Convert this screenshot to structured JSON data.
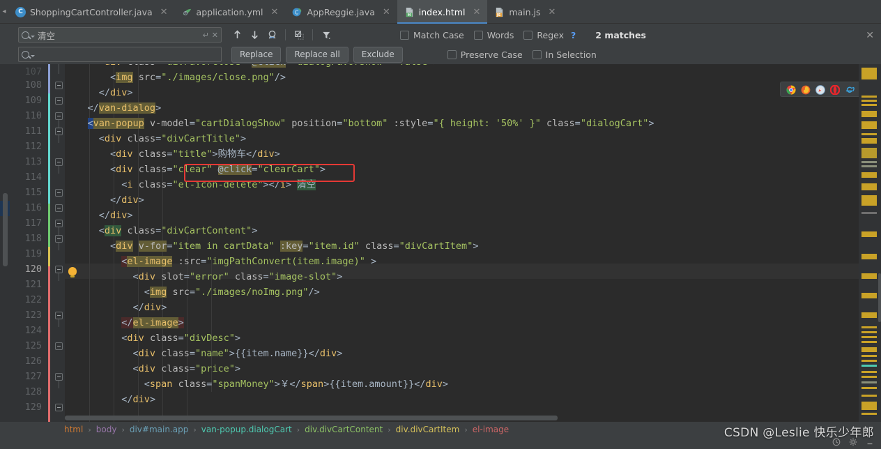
{
  "tabs": [
    {
      "label": "ShoppingCartController.java",
      "icon": "java-class-icon",
      "active": false
    },
    {
      "label": "application.yml",
      "icon": "yaml-file-icon",
      "active": false
    },
    {
      "label": "AppReggie.java",
      "icon": "spring-boot-class-icon",
      "active": false
    },
    {
      "label": "index.html",
      "icon": "html-file-icon",
      "active": true
    },
    {
      "label": "main.js",
      "icon": "javascript-file-icon",
      "active": false
    }
  ],
  "find": {
    "search_value": "清空",
    "replace_placeholder": "",
    "buttons": {
      "replace": "Replace",
      "replace_all": "Replace all",
      "exclude": "Exclude"
    },
    "options": {
      "match_case": "Match Case",
      "words": "Words",
      "regex": "Regex",
      "help": "?",
      "preserve_case": "Preserve Case",
      "in_selection": "In Selection"
    },
    "result_count": "2 matches",
    "icons": [
      "find-previous-icon",
      "find-next-icon",
      "find-in-path-icon",
      "select-all-occurrences-icon",
      "filter-icon",
      "close-icon"
    ]
  },
  "editor": {
    "first_line": 107,
    "current_line": 120,
    "lines": [
      {
        "num": 107,
        "partial": true,
        "text": "<div class=\"divFavorClose\" @click=\"dialogFavorShow = false\">"
      },
      {
        "num": 108,
        "text": "  <img src=\"./images/close.png\"/>"
      },
      {
        "num": 109,
        "text": "</div>"
      },
      {
        "num": 110,
        "text": "</van-dialog>"
      },
      {
        "num": 111,
        "text": "<van-popup v-model=\"cartDialogShow\" position=\"bottom\" :style=\"{ height: '50%' }\" class=\"dialogCart\">"
      },
      {
        "num": 112,
        "text": "  <div class=\"divCartTitle\">"
      },
      {
        "num": 113,
        "text": "    <div class=\"title\">购物车</div>"
      },
      {
        "num": 114,
        "text": "    <div class=\"clear\" @click=\"clearCart\">"
      },
      {
        "num": 115,
        "text": "      <i class=\"el-icon-delete\"></i> 清空"
      },
      {
        "num": 116,
        "text": "    </div>"
      },
      {
        "num": 117,
        "text": "  </div>"
      },
      {
        "num": 118,
        "text": "  <div class=\"divCartContent\">"
      },
      {
        "num": 119,
        "text": "    <div v-for=\"item in cartData\" :key=\"item.id\" class=\"divCartItem\">"
      },
      {
        "num": 120,
        "text": "      <el-image :src=\"imgPathConvert(item.image)\" >"
      },
      {
        "num": 121,
        "text": "        <div slot=\"error\" class=\"image-slot\">"
      },
      {
        "num": 122,
        "text": "          <img src=\"./images/noImg.png\"/>"
      },
      {
        "num": 123,
        "text": "        </div>"
      },
      {
        "num": 124,
        "text": "      </el-image>"
      },
      {
        "num": 125,
        "text": "      <div class=\"divDesc\">"
      },
      {
        "num": 126,
        "text": "        <div class=\"name\">{{item.name}}</div>"
      },
      {
        "num": 127,
        "text": "        <div class=\"price\">"
      },
      {
        "num": 128,
        "text": "          <span class=\"spanMoney\">￥</span>{{item.amount}}</div>"
      },
      {
        "num": 129,
        "text": "      </div>"
      }
    ],
    "annotation": {
      "type": "red-rectangle",
      "target": "@click=\"clearCart\">"
    },
    "intention_bulb_line": 120,
    "browsers": [
      "chrome-icon",
      "firefox-icon",
      "safari-icon",
      "opera-icon",
      "internet-explorer-icon",
      "edge-icon"
    ]
  },
  "breadcrumb": [
    {
      "label": "html",
      "color": "#cc7832"
    },
    {
      "label": "body",
      "color": "#9876aa"
    },
    {
      "label": "div#main.app",
      "color": "#6a9fb5"
    },
    {
      "label": "van-popup.dialogCart",
      "color": "#4ec9b0"
    },
    {
      "label": "div.divCartContent",
      "color": "#8cc265"
    },
    {
      "label": "div.divCartItem",
      "color": "#d4c05a"
    },
    {
      "label": "el-image",
      "color": "#cc6666"
    }
  ],
  "watermark": "CSDN @Leslie 快乐少年郎",
  "statusbar_icons": [
    "clock-icon",
    "gear-icon",
    "minimize-icon"
  ],
  "colors": {
    "accent": "#4a88c7",
    "editor_bg": "#2b2b2b",
    "chrome_bg": "#3c3f41",
    "annotation_red": "#e53935",
    "match_highlight": "#32593d"
  }
}
